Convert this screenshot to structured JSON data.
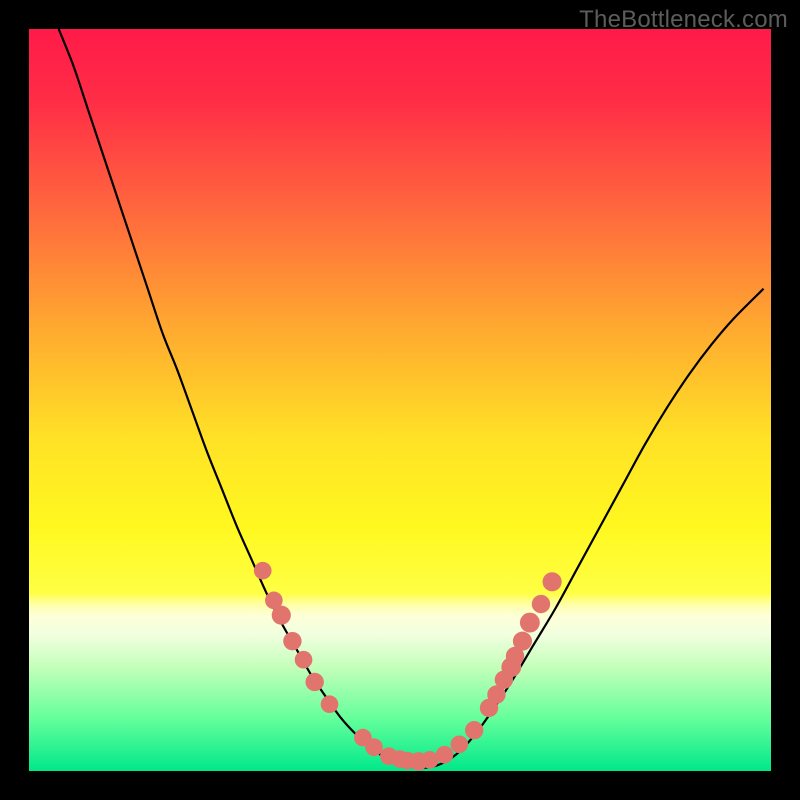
{
  "watermark": "TheBottleneck.com",
  "colors": {
    "bg_black": "#000000",
    "curve": "#000000",
    "marker_fill": "#e2746e",
    "marker_stroke": "#d85f59",
    "gradient_stops": [
      {
        "offset": 0.0,
        "color": "#ff1a49"
      },
      {
        "offset": 0.1,
        "color": "#ff2e46"
      },
      {
        "offset": 0.25,
        "color": "#ff6a3d"
      },
      {
        "offset": 0.4,
        "color": "#ffa830"
      },
      {
        "offset": 0.55,
        "color": "#ffe126"
      },
      {
        "offset": 0.67,
        "color": "#fff81f"
      },
      {
        "offset": 0.76,
        "color": "#ffff44"
      },
      {
        "offset": 0.775,
        "color": "#ffffa4"
      },
      {
        "offset": 0.79,
        "color": "#fdffd6"
      },
      {
        "offset": 0.815,
        "color": "#f2ffe0"
      },
      {
        "offset": 0.86,
        "color": "#c4ffba"
      },
      {
        "offset": 0.93,
        "color": "#63ff9b"
      },
      {
        "offset": 1.0,
        "color": "#00e88a"
      }
    ]
  },
  "chart_data": {
    "type": "line",
    "title": "",
    "xlabel": "",
    "ylabel": "",
    "xlim": [
      0,
      100
    ],
    "ylim": [
      0,
      100
    ],
    "grid": false,
    "series": [
      {
        "name": "bottleneck-curve",
        "x": [
          4,
          6,
          8,
          10,
          12,
          14,
          16,
          18,
          20,
          22,
          24,
          26,
          28,
          30,
          32,
          34,
          36,
          38,
          40,
          42,
          44,
          46,
          48,
          50,
          52,
          54,
          56,
          58,
          60,
          62,
          65,
          68,
          71,
          74,
          77,
          80,
          83,
          86,
          89,
          92,
          95,
          99
        ],
        "y": [
          100,
          95,
          89,
          83,
          77,
          71,
          65,
          59,
          54,
          48.5,
          43,
          38,
          33,
          28.5,
          24,
          20,
          16.5,
          13,
          10,
          7.2,
          5,
          3.2,
          1.8,
          0.9,
          0.5,
          0.5,
          1.2,
          2.6,
          4.8,
          7.5,
          12,
          17,
          22,
          27.5,
          33,
          38.5,
          44,
          49,
          53.5,
          57.5,
          61,
          65
        ]
      }
    ],
    "markers": [
      {
        "x": 31.5,
        "y": 27.0,
        "r": 1.3
      },
      {
        "x": 33.0,
        "y": 23.0,
        "r": 1.3
      },
      {
        "x": 34.0,
        "y": 21.0,
        "r": 1.5
      },
      {
        "x": 35.5,
        "y": 17.5,
        "r": 1.4
      },
      {
        "x": 37.0,
        "y": 15.0,
        "r": 1.3
      },
      {
        "x": 38.5,
        "y": 12.0,
        "r": 1.4
      },
      {
        "x": 40.5,
        "y": 9.0,
        "r": 1.3
      },
      {
        "x": 45.0,
        "y": 4.5,
        "r": 1.3
      },
      {
        "x": 46.5,
        "y": 3.2,
        "r": 1.3
      },
      {
        "x": 48.5,
        "y": 2.0,
        "r": 1.3
      },
      {
        "x": 50.0,
        "y": 1.6,
        "r": 1.3
      },
      {
        "x": 51.0,
        "y": 1.4,
        "r": 1.3
      },
      {
        "x": 52.5,
        "y": 1.3,
        "r": 1.4
      },
      {
        "x": 54.0,
        "y": 1.5,
        "r": 1.3
      },
      {
        "x": 56.0,
        "y": 2.2,
        "r": 1.3
      },
      {
        "x": 58.0,
        "y": 3.6,
        "r": 1.3
      },
      {
        "x": 60.0,
        "y": 5.5,
        "r": 1.4
      },
      {
        "x": 62.0,
        "y": 8.5,
        "r": 1.4
      },
      {
        "x": 63.0,
        "y": 10.3,
        "r": 1.4
      },
      {
        "x": 64.0,
        "y": 12.3,
        "r": 1.4
      },
      {
        "x": 65.0,
        "y": 14.0,
        "r": 1.6
      },
      {
        "x": 65.5,
        "y": 15.5,
        "r": 1.4
      },
      {
        "x": 66.5,
        "y": 17.5,
        "r": 1.5
      },
      {
        "x": 67.5,
        "y": 20.0,
        "r": 1.6
      },
      {
        "x": 69.0,
        "y": 22.5,
        "r": 1.4
      },
      {
        "x": 70.5,
        "y": 25.5,
        "r": 1.5
      }
    ]
  }
}
